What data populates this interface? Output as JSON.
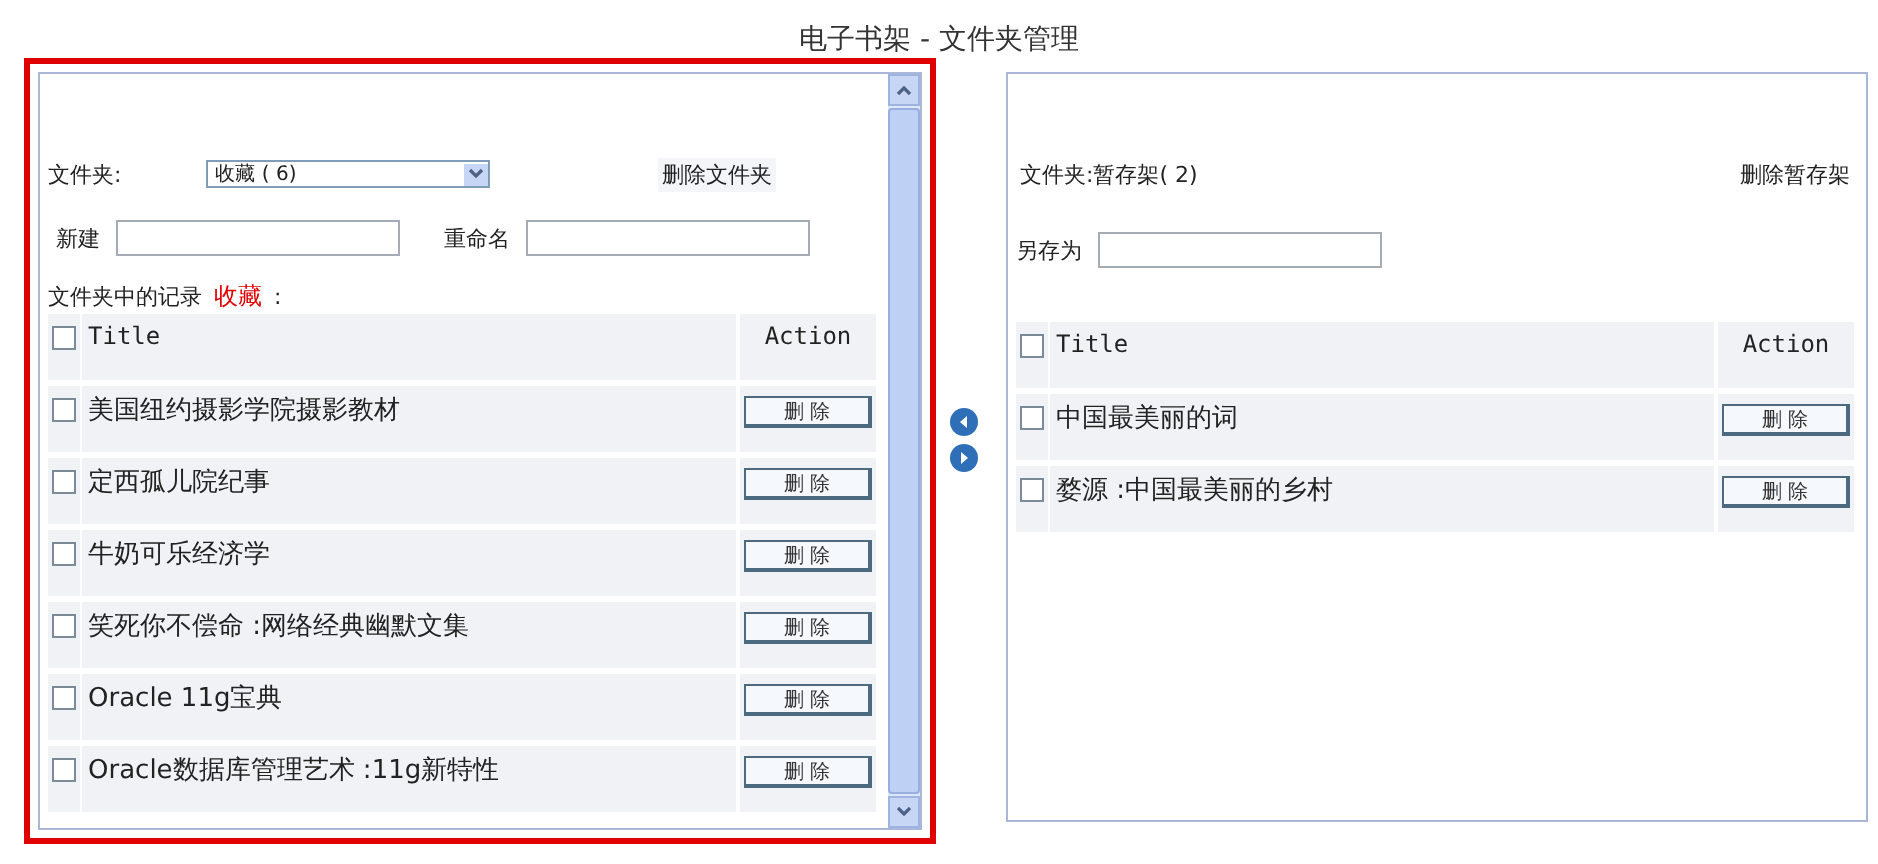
{
  "page_title": "电子书架 - 文件夹管理",
  "left_panel": {
    "highlighted": true,
    "folder_label": "文件夹:",
    "folder_select": "收藏 ( 6)",
    "delete_folder": "删除文件夹",
    "new_label": "新建",
    "rename_label": "重命名",
    "records_label": "文件夹中的记录",
    "records_folder": "收藏",
    "records_colon": ":",
    "columns": [
      "Title",
      "Action"
    ],
    "select_all_checked": false,
    "rows": [
      {
        "title": "美国纽约摄影学院摄影教材",
        "checked": false,
        "action": "删 除"
      },
      {
        "title": "定西孤儿院纪事",
        "checked": false,
        "action": "删 除"
      },
      {
        "title": "牛奶可乐经济学",
        "checked": false,
        "action": "删 除"
      },
      {
        "title": "笑死你不偿命 :网络经典幽默文集",
        "checked": false,
        "action": "删 除"
      },
      {
        "title": "Oracle 11g宝典",
        "checked": false,
        "action": "删 除"
      },
      {
        "title": "Oracle数据库管理艺术 :11g新特性",
        "checked": false,
        "action": "删 除"
      }
    ]
  },
  "right_panel": {
    "folder_label": "文件夹:暂存架( 2)",
    "delete_folder": "删除暂存架",
    "save_as_label": "另存为",
    "columns": [
      "Title",
      "Action"
    ],
    "select_all_checked": false,
    "rows": [
      {
        "title": "中国最美丽的词",
        "checked": false,
        "action": "删 除"
      },
      {
        "title": "婺源 :中国最美丽的乡村",
        "checked": false,
        "action": "删 除"
      }
    ]
  }
}
